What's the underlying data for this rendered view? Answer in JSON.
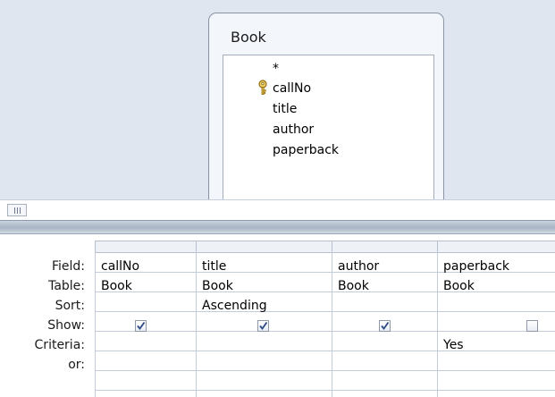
{
  "table": {
    "name": "Book",
    "fields": [
      "*",
      "callNo",
      "title",
      "author",
      "paperback"
    ],
    "primary_key": "callNo"
  },
  "grid": {
    "row_labels": {
      "field": "Field:",
      "table": "Table:",
      "sort": "Sort:",
      "show": "Show:",
      "criteria": "Criteria:",
      "or": "or:"
    },
    "columns": [
      {
        "field": "callNo",
        "table": "Book",
        "sort": "",
        "show": true,
        "criteria": ""
      },
      {
        "field": "title",
        "table": "Book",
        "sort": "Ascending",
        "show": true,
        "criteria": ""
      },
      {
        "field": "author",
        "table": "Book",
        "sort": "",
        "show": true,
        "criteria": ""
      },
      {
        "field": "paperback",
        "table": "Book",
        "sort": "",
        "show": false,
        "criteria": "Yes"
      }
    ]
  },
  "icons": {
    "key": "primary-key-icon",
    "checkmark": "checkmark-icon",
    "grip": "scroll-grip-icon"
  },
  "colors": {
    "pane_background": "#dfe6f0",
    "grid_lines": "#c3ccd8",
    "splitter": "#a9b5c5",
    "key_gold": "#c9a227"
  }
}
